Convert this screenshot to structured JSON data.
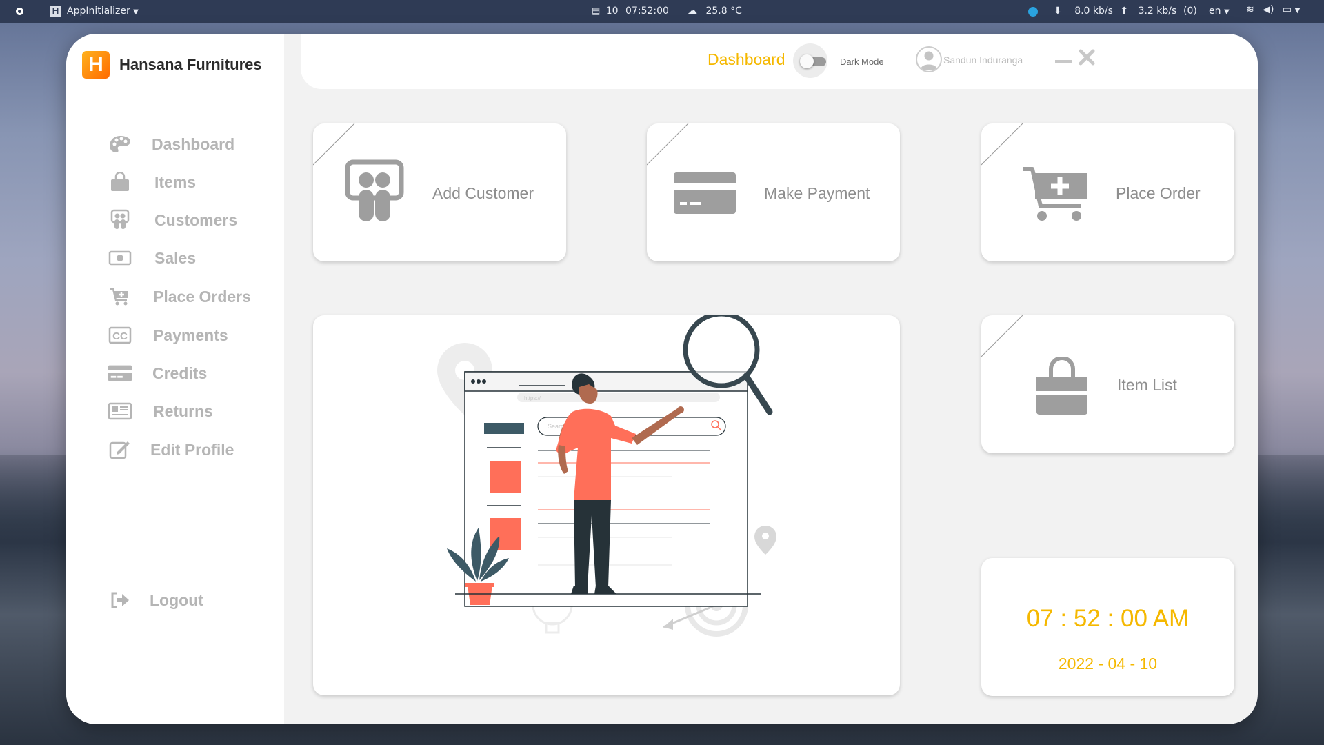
{
  "topbar": {
    "app_name": "AppInitializer",
    "date_icon_text": "ꔋ",
    "date": "10",
    "time": "07:52:00",
    "temperature": "25.8 °C",
    "down_speed": "8.0 kb/s",
    "up_speed": "3.2 kb/s",
    "notifications": "(0)",
    "language": "en"
  },
  "sidebar": {
    "brand_logo": "H",
    "brand_name": "Hansana Furnitures",
    "items": [
      {
        "label": "Dashboard",
        "icon": "palette-icon"
      },
      {
        "label": "Items",
        "icon": "shopping-bag-icon"
      },
      {
        "label": "Customers",
        "icon": "customers-icon"
      },
      {
        "label": "Sales",
        "icon": "money-icon"
      },
      {
        "label": "Place Orders",
        "icon": "cart-plus-icon"
      },
      {
        "label": "Payments",
        "icon": "credit-card-cc-icon"
      },
      {
        "label": "Credits",
        "icon": "credit-card-icon"
      },
      {
        "label": "Returns",
        "icon": "newspaper-icon"
      },
      {
        "label": "Edit Profile",
        "icon": "edit-icon"
      }
    ],
    "logout": "Logout"
  },
  "header": {
    "title": "Dashboard",
    "dark_mode_label": "Dark Mode",
    "user_name": "Sandun Induranga"
  },
  "cards": {
    "add_customer": "Add Customer",
    "make_payment": "Make Payment",
    "place_order": "Place Order",
    "item_list": "Item List"
  },
  "clock": {
    "time": "07 : 52 : 00 AM",
    "date": "2022 - 04 - 10"
  },
  "illustration": {
    "url_text": "https://",
    "search_placeholder": "Search ..."
  },
  "colors": {
    "accent": "#f5b800",
    "brand_orange": "#ff7a00",
    "illustration_coral": "#ff6f59",
    "illustration_dark": "#263238",
    "muted_text": "#8e8e8e"
  }
}
